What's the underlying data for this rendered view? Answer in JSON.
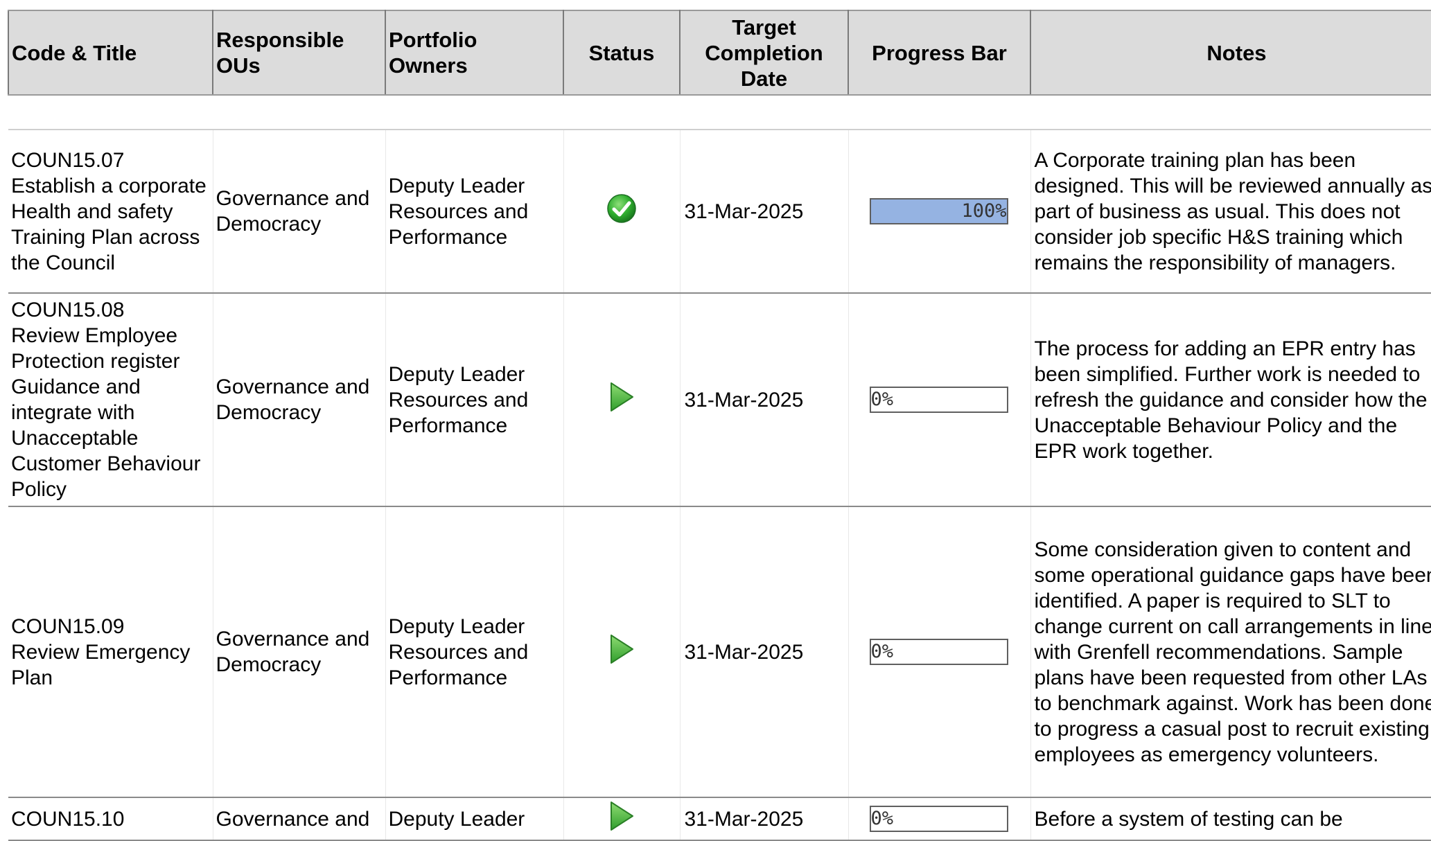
{
  "headers": {
    "code_title": "Code & Title",
    "responsible_ous": "Responsible OUs",
    "portfolio_owners": "Portfolio Owners",
    "status": "Status",
    "target_date": "Target Completion Date",
    "progress_bar": "Progress Bar",
    "notes": "Notes"
  },
  "colors": {
    "progress_fill": "#95b3e2",
    "status_complete": "#2fae2f",
    "status_in_progress": "#56c04a",
    "header_bg": "#dcdcdc"
  },
  "rows": [
    {
      "code": "COUN15.07",
      "title": "Establish a corporate Health and safety Training Plan across the Council",
      "ous": "Governance and Democracy",
      "owners": "Deputy Leader Resources and Performance",
      "status_icon": "check-circle-icon",
      "date": "31-Mar-2025",
      "progress": 100,
      "progress_label": "100%",
      "notes": "A Corporate training plan has been designed. This will be reviewed annually as part of business as usual. This does not consider job specific H&S training which remains the responsibility of managers."
    },
    {
      "code": "COUN15.08",
      "title": "Review Employee Protection register Guidance and integrate with Unacceptable Customer Behaviour Policy",
      "ous": "Governance and Democracy",
      "owners": "Deputy Leader Resources and Performance",
      "status_icon": "play-triangle-icon",
      "date": "31-Mar-2025",
      "progress": 0,
      "progress_label": "0%",
      "notes": "The process for adding an EPR entry has been simplified. Further work is needed to refresh the guidance and consider how the Unacceptable Behaviour Policy and the EPR work together."
    },
    {
      "code": "COUN15.09",
      "title": "Review Emergency Plan",
      "ous": "Governance and Democracy",
      "owners": "Deputy Leader Resources and Performance",
      "status_icon": "play-triangle-icon",
      "date": "31-Mar-2025",
      "progress": 0,
      "progress_label": "0%",
      "notes": "Some consideration given to content and some operational guidance gaps have been identified. A paper is required to SLT to change current on call arrangements in line with Grenfell recommendations. Sample plans have been requested from other LAs to benchmark against. Work has been done to progress a casual post to recruit existing employees as emergency volunteers."
    },
    {
      "code": "COUN15.10",
      "title": "",
      "ous": "Governance and",
      "owners": "Deputy Leader",
      "status_icon": "play-triangle-icon",
      "date": "31-Mar-2025",
      "progress": 0,
      "progress_label": "0%",
      "notes": "Before a system of testing can be"
    }
  ]
}
